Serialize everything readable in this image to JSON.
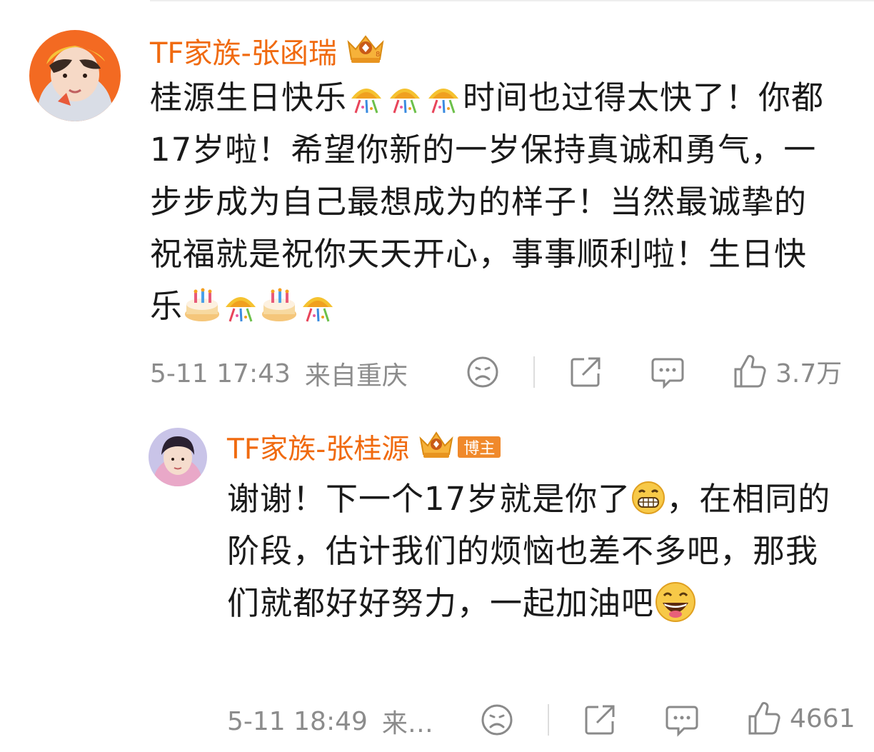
{
  "comments": [
    {
      "username": "TF家族-张函瑞",
      "text_segments": [
        "桂源生日快乐",
        "时间也过得太快了！你都17岁啦！希望你新的一岁保持真诚和勇气，一步步成为自己最想成为的样子！当然最诚挚的祝福就是祝你天天开心，事事顺利啦！生日快乐"
      ],
      "emojis": [
        "party-popper-emoji",
        "party-popper-emoji",
        "party-popper-emoji",
        "birthday-cake-emoji",
        "party-popper-emoji",
        "birthday-cake-emoji",
        "party-popper-emoji"
      ],
      "time": "5-11 17:43",
      "location": "来自重庆",
      "likes": "3.7万"
    },
    {
      "username": "TF家族-张桂源",
      "badge_label": "博主",
      "text_segments": [
        "谢谢！下一个17岁就是你了",
        "，在相同的阶段，估计我们的烦恼也差不多吧，那我们就都好好努力，一起加油吧"
      ],
      "emojis": [
        "grinning-teeth-emoji",
        "laughing-face-emoji"
      ],
      "time": "5-11 18:49",
      "location": "来…",
      "likes": "4661"
    }
  ],
  "colors": {
    "username": "#f06a0f",
    "meta": "#8c8c8c",
    "text": "#1a1a1a",
    "badge_bg": "#f0892b"
  }
}
